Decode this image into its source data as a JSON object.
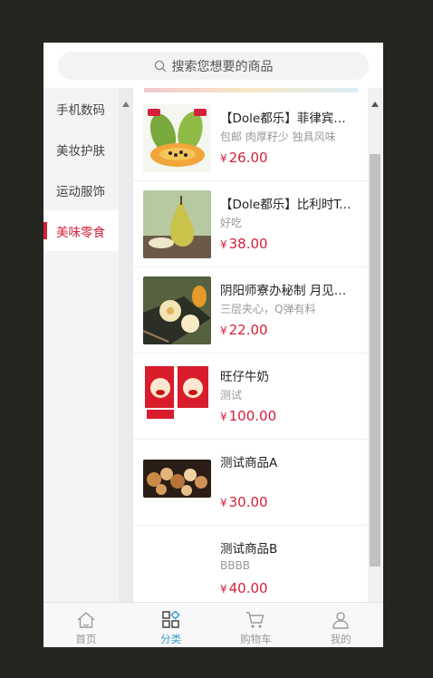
{
  "search": {
    "placeholder": "搜索您想要的商品"
  },
  "sidebar": {
    "items": [
      {
        "label": "手机数码",
        "active": false
      },
      {
        "label": "美妆护肤",
        "active": false
      },
      {
        "label": "运动服饰",
        "active": false
      },
      {
        "label": "美味零食",
        "active": true
      }
    ]
  },
  "products": [
    {
      "name": "【Dole都乐】菲律宾木瓜…",
      "desc": "包邮 肉厚籽少 独具风味",
      "yen": "¥",
      "price": "26.00",
      "thumb": "papaya"
    },
    {
      "name": "【Dole都乐】比利时Te…",
      "desc": "好吃",
      "yen": "¥",
      "price": "38.00",
      "thumb": "pear"
    },
    {
      "name": "阴阳师寮办秘制 月见…",
      "desc": "三层夹心，Q弹有料",
      "yen": "¥",
      "price": "22.00",
      "thumb": "mochi"
    },
    {
      "name": "旺仔牛奶",
      "desc": "测试",
      "yen": "¥",
      "price": "100.00",
      "thumb": "milk"
    },
    {
      "name": "测试商品A",
      "desc": "",
      "yen": "¥",
      "price": "30.00",
      "thumb": "cookies"
    },
    {
      "name": "测试商品B",
      "desc": "BBBB",
      "yen": "¥",
      "price": "40.00",
      "thumb": "none"
    }
  ],
  "tabbar": {
    "tabs": [
      {
        "label": "首页",
        "icon": "home-icon",
        "active": false
      },
      {
        "label": "分类",
        "icon": "category-icon",
        "active": true
      },
      {
        "label": "购物车",
        "icon": "cart-icon",
        "active": false
      },
      {
        "label": "我的",
        "icon": "user-icon",
        "active": false
      }
    ]
  },
  "colors": {
    "accent": "#d4203b",
    "tab_active": "#3aa0c8"
  }
}
